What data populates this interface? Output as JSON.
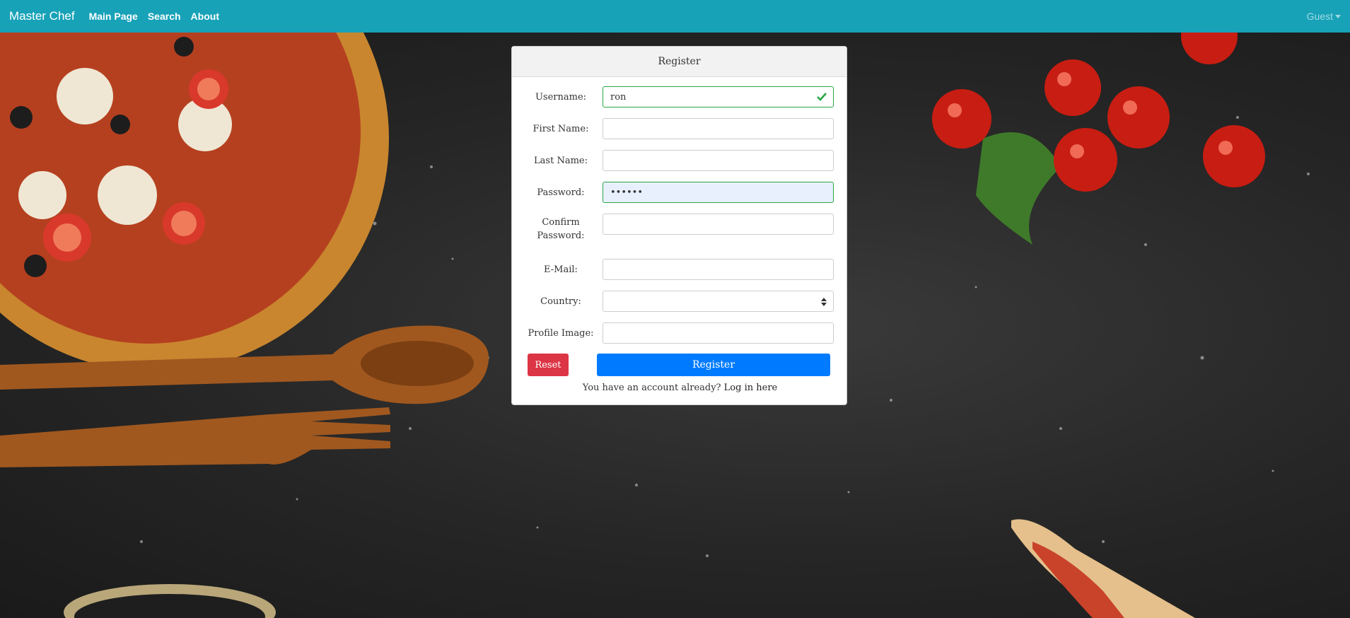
{
  "navbar": {
    "brand": "Master Chef",
    "links": [
      "Main Page",
      "Search",
      "About"
    ],
    "user": "Guest"
  },
  "form": {
    "title": "Register",
    "fields": [
      {
        "label": "Username:",
        "value": "ron",
        "valid": true
      },
      {
        "label": "First Name:",
        "value": ""
      },
      {
        "label": "Last Name:",
        "value": ""
      },
      {
        "label": "Password:",
        "value": "••••••",
        "valid": true
      },
      {
        "label": "Confirm Password:",
        "value": ""
      },
      {
        "label": "E-Mail:",
        "value": ""
      },
      {
        "label": "Country:",
        "value": ""
      },
      {
        "label": "Profile Image:",
        "value": ""
      }
    ],
    "reset_label": "Reset",
    "register_label": "Register",
    "footer_prefix": "You have an account already?",
    "login_link": "Log in here"
  },
  "colors": {
    "navbar": "#17a2b8",
    "primary": "#007bff",
    "danger": "#dc3545",
    "valid": "#28a745"
  },
  "icons": [
    "check-icon",
    "select-arrows-icon",
    "caret-down-icon"
  ]
}
